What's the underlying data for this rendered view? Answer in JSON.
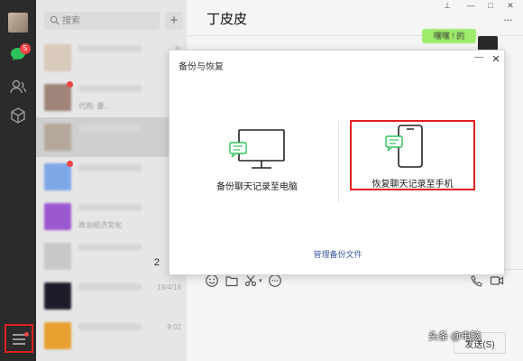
{
  "window": {
    "pin": "⊥",
    "minimize": "—",
    "maximize": "□",
    "close": "✕"
  },
  "sidebar": {
    "unread_badge": "5"
  },
  "search": {
    "placeholder": "搜索",
    "add": "+"
  },
  "chat_list": {
    "rows": [
      {
        "time": "9:",
        "preview": "",
        "avatar_color": "#d9c9bb",
        "selected": false,
        "unread": false
      },
      {
        "time": "9:",
        "preview": "代购: 要...",
        "avatar_color": "#a0847a",
        "selected": false,
        "unread": true
      },
      {
        "time": "1",
        "preview": "",
        "avatar_color": "#b5a89a",
        "selected": true,
        "unread": false
      },
      {
        "time": "",
        "preview": "",
        "avatar_color": "#7ea7e8",
        "selected": false,
        "unread": true
      },
      {
        "time": "",
        "preview": "政治经济文化",
        "avatar_color": "#9b59d0",
        "selected": false,
        "unread": false
      },
      {
        "time": "",
        "preview": "",
        "avatar_color": "#c8c8c8",
        "selected": false,
        "unread": false,
        "count": "2"
      },
      {
        "time": "19/4/18",
        "preview": "",
        "avatar_color": "#1d1d2a",
        "selected": false,
        "unread": false
      },
      {
        "time": "9:02",
        "preview": "",
        "avatar_color": "#e8a030",
        "selected": false,
        "unread": false
      }
    ]
  },
  "chat": {
    "title": "丁皮皮",
    "more": "···",
    "message_preview": "嘿嘿 ! 的",
    "send_label": "发送(S)"
  },
  "modal": {
    "title": "备份与恢复",
    "minimize": "—",
    "close": "✕",
    "backup_label": "备份聊天记录至电脑",
    "restore_label": "恢复聊天记录至手机",
    "manage_link": "管理备份文件"
  },
  "watermark": "头条 @电脑"
}
